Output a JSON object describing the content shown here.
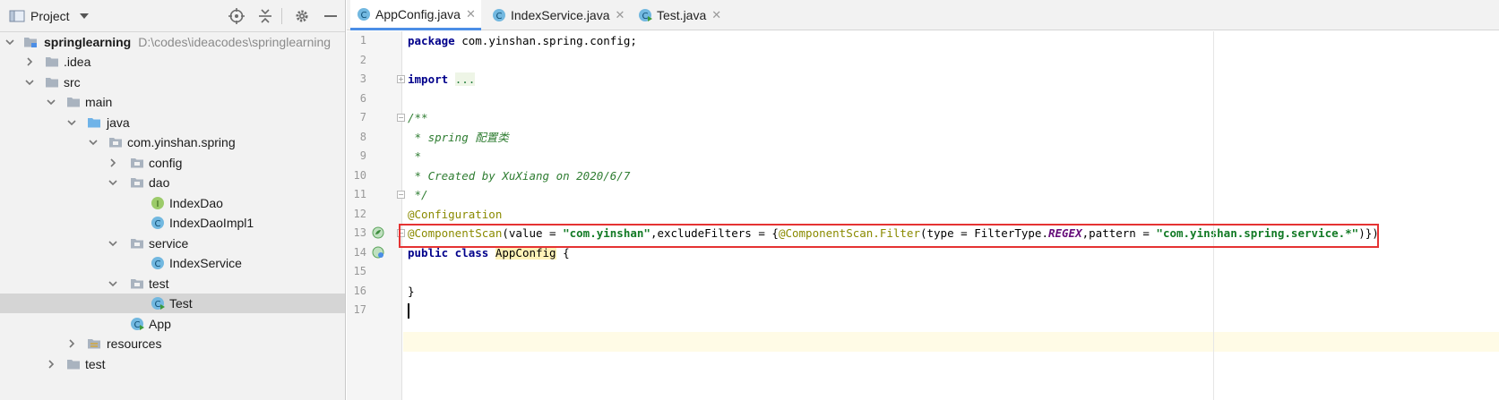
{
  "project_panel": {
    "title": "Project",
    "tree": [
      {
        "label": "springlearning",
        "path": "D:\\codes\\ideacodes\\springlearning",
        "depth": 0,
        "icon": "module-folder-icon",
        "expanded": true
      },
      {
        "label": ".idea",
        "depth": 1,
        "icon": "folder-icon",
        "expanded": false
      },
      {
        "label": "src",
        "depth": 1,
        "icon": "folder-icon",
        "expanded": true
      },
      {
        "label": "main",
        "depth": 2,
        "icon": "folder-icon",
        "expanded": true
      },
      {
        "label": "java",
        "depth": 3,
        "icon": "source-folder-icon",
        "expanded": true
      },
      {
        "label": "com.yinshan.spring",
        "depth": 4,
        "icon": "package-icon",
        "expanded": true
      },
      {
        "label": "config",
        "depth": 5,
        "icon": "package-icon",
        "expanded": false
      },
      {
        "label": "dao",
        "depth": 5,
        "icon": "package-icon",
        "expanded": true
      },
      {
        "label": "IndexDao",
        "depth": 6,
        "icon": "interface-icon"
      },
      {
        "label": "IndexDaoImpl1",
        "depth": 6,
        "icon": "class-icon"
      },
      {
        "label": "service",
        "depth": 5,
        "icon": "package-icon",
        "expanded": true
      },
      {
        "label": "IndexService",
        "depth": 6,
        "icon": "class-icon"
      },
      {
        "label": "test",
        "depth": 5,
        "icon": "package-icon",
        "expanded": true
      },
      {
        "label": "Test",
        "depth": 6,
        "icon": "runnable-class-icon",
        "selected": true
      },
      {
        "label": "App",
        "depth": 5,
        "icon": "runnable-class-icon"
      },
      {
        "label": "resources",
        "depth": 3,
        "icon": "resources-folder-icon",
        "expanded": false
      },
      {
        "label": "test",
        "depth": 2,
        "icon": "folder-icon",
        "expanded": false
      }
    ]
  },
  "tabs": [
    {
      "label": "AppConfig.java",
      "active": true
    },
    {
      "label": "IndexService.java",
      "active": false
    },
    {
      "label": "Test.java",
      "active": false
    }
  ],
  "gutter": {
    "line_numbers": [
      "1",
      "2",
      "3",
      "6",
      "7",
      "8",
      "9",
      "10",
      "11",
      "12",
      "13",
      "14",
      "15",
      "16",
      "17"
    ]
  },
  "code": {
    "package_kw": "package",
    "package_name": " com.yinshan.spring.config;",
    "import_kw": "import",
    "import_dots": "...",
    "doc_open": "/**",
    "doc_line1": " * spring 配置类",
    "doc_line2": " *",
    "doc_line3": " * Created by XuXiang on 2020/6/7",
    "doc_close": " */",
    "annotation_config": "@Configuration",
    "annotation_scan": "@ComponentScan",
    "scan_args1": "(value = ",
    "scan_value": "\"com.yinshan\"",
    "scan_args2": ",excludeFilters = {",
    "scan_filter": "@ComponentScan.Filter",
    "scan_args3": "(type = FilterType.",
    "scan_regex": "REGEX",
    "scan_args4": ",pattern = ",
    "scan_pattern": "\"com.yinshan.spring.service.*\"",
    "scan_args5": ")})",
    "class_kw": "public class",
    "class_name": "AppConfig",
    "class_open": " {",
    "class_close": "}"
  },
  "colors": {
    "accent": "#4b8ee6",
    "highlight_border": "#e53333"
  }
}
